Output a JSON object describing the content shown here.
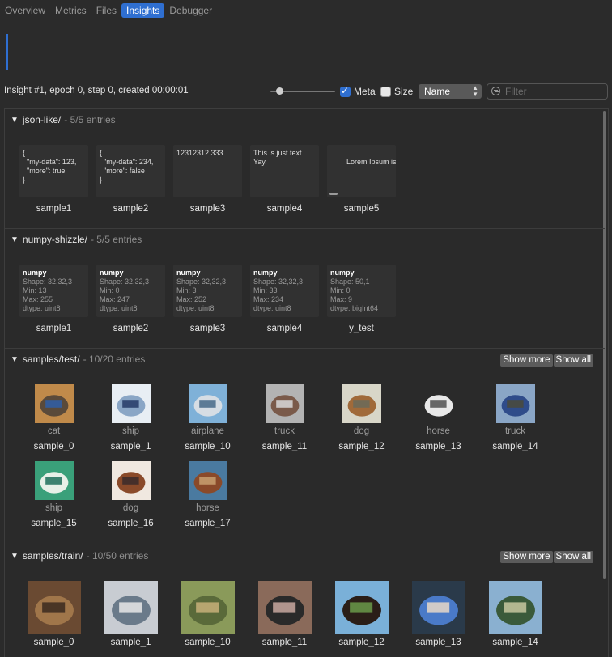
{
  "tabs": [
    {
      "label": "Overview",
      "active": false
    },
    {
      "label": "Metrics",
      "active": false
    },
    {
      "label": "Files",
      "active": false
    },
    {
      "label": "Insights",
      "active": true
    },
    {
      "label": "Debugger",
      "active": false
    }
  ],
  "infobar": {
    "text": "Insight #1, epoch 0, step 0, created 00:00:01",
    "slider_value": 0,
    "meta": {
      "label": "Meta",
      "checked": true
    },
    "size": {
      "label": "Size",
      "checked": false
    },
    "sort_select": "Name",
    "filter_placeholder": "Filter"
  },
  "sections": [
    {
      "title": "json-like/",
      "count": "- 5/5 entries",
      "entries": [
        {
          "label": "sample1",
          "content": "{\n  \"my-data\": 123,\n  \"more\": true\n}"
        },
        {
          "label": "sample2",
          "content": "{\n  \"my-data\": 234,\n  \"more\": false\n}"
        },
        {
          "label": "sample3",
          "content": "12312312.333"
        },
        {
          "label": "sample4",
          "content": "This is just text\nYay."
        },
        {
          "label": "sample5",
          "content": "Lorem Ipsum is sin"
        }
      ]
    },
    {
      "title": "numpy-shizzle/",
      "count": "- 5/5 entries",
      "entries": [
        {
          "label": "sample1",
          "kind": "numpy",
          "lines": [
            "Shape: 32,32,3",
            "Min: 13",
            "Max: 255",
            "dtype: uint8"
          ]
        },
        {
          "label": "sample2",
          "kind": "numpy",
          "lines": [
            "Shape: 32,32,3",
            "Min: 0",
            "Max: 247",
            "dtype: uint8"
          ]
        },
        {
          "label": "sample3",
          "kind": "numpy",
          "lines": [
            "Shape: 32,32,3",
            "Min: 3",
            "Max: 252",
            "dtype: uint8"
          ]
        },
        {
          "label": "sample4",
          "kind": "numpy",
          "lines": [
            "Shape: 32,32,3",
            "Min: 33",
            "Max: 234",
            "dtype: uint8"
          ]
        },
        {
          "label": "y_test",
          "kind": "numpy",
          "lines": [
            "Shape: 50,1",
            "Min: 0",
            "Max: 9",
            "dtype: bigInt64"
          ]
        }
      ]
    },
    {
      "title": "samples/test/",
      "count": "- 10/20 entries",
      "show_more": "Show more",
      "show_all": "Show all",
      "entries": [
        {
          "label": "sample_0",
          "caption": "cat",
          "palette": [
            "#c08a4a",
            "#5a4a3a",
            "#2f5ea8"
          ]
        },
        {
          "label": "sample_1",
          "caption": "ship",
          "palette": [
            "#e8eef4",
            "#8aa6c6",
            "#243a66"
          ]
        },
        {
          "label": "sample_10",
          "caption": "airplane",
          "palette": [
            "#7fb1d8",
            "#d6dde4",
            "#486a88"
          ]
        },
        {
          "label": "sample_11",
          "caption": "truck",
          "palette": [
            "#b3b3b3",
            "#7a5a4a",
            "#d8d8d8"
          ]
        },
        {
          "label": "sample_12",
          "caption": "dog",
          "palette": [
            "#d8d6c8",
            "#a06a3a",
            "#6a6a5a"
          ]
        },
        {
          "label": "sample_13",
          "caption": "horse",
          "palette": [
            "#2a2a2a",
            "#e8e8e8",
            "#505050"
          ]
        },
        {
          "label": "sample_14",
          "caption": "truck",
          "palette": [
            "#8aa6c6",
            "#2f4c8a",
            "#4a4a3a"
          ]
        },
        {
          "label": "sample_15",
          "caption": "ship",
          "palette": [
            "#3aa07a",
            "#e8f0e8",
            "#1f6f5a"
          ]
        },
        {
          "label": "sample_16",
          "caption": "dog",
          "palette": [
            "#f0e8e0",
            "#8a4a2a",
            "#3a2a2a"
          ]
        },
        {
          "label": "sample_17",
          "caption": "horse",
          "palette": [
            "#4a7aa0",
            "#8a4a2a",
            "#c8a070"
          ]
        }
      ]
    },
    {
      "title": "samples/train/",
      "count": "- 10/50 entries",
      "show_more": "Show more",
      "show_all": "Show all",
      "entries": [
        {
          "label": "sample_0",
          "palette": [
            "#6a4a32",
            "#a0764a",
            "#3a2a1e"
          ]
        },
        {
          "label": "sample_1",
          "palette": [
            "#c8ccd2",
            "#6a7a8a",
            "#e8e8e8"
          ]
        },
        {
          "label": "sample_10",
          "palette": [
            "#8a9a5a",
            "#5a6a3a",
            "#c8b07a"
          ]
        },
        {
          "label": "sample_11",
          "palette": [
            "#8a6a5a",
            "#2a2a2a",
            "#c8a8a0"
          ]
        },
        {
          "label": "sample_12",
          "palette": [
            "#7ab0d8",
            "#2a1e18",
            "#6a9a4a"
          ]
        },
        {
          "label": "sample_13",
          "palette": [
            "#2a3a4a",
            "#4a7ac8",
            "#e8d8c8"
          ]
        },
        {
          "label": "sample_14",
          "palette": [
            "#8ab0d0",
            "#3a5a3a",
            "#c8c8a0"
          ]
        }
      ]
    }
  ]
}
